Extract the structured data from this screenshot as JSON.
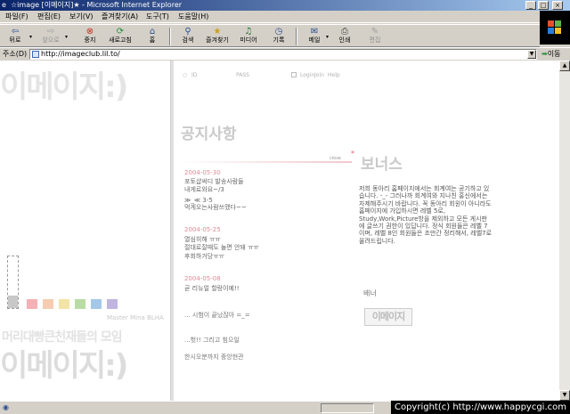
{
  "window": {
    "title": "☆image [이메이지]★ - Microsoft Internet Explorer"
  },
  "menu": [
    "파일(F)",
    "편집(E)",
    "보기(V)",
    "즐겨찾기(A)",
    "도구(T)",
    "도움말(H)"
  ],
  "toolbar": {
    "back": "뒤로",
    "forward": "앞으로",
    "stop": "중지",
    "refresh": "새로고침",
    "home": "홈",
    "search": "검색",
    "favorites": "즐겨찾기",
    "media": "미디어",
    "history": "기록",
    "mail": "메일",
    "print": "인쇄",
    "edit": "편집"
  },
  "address": {
    "label": "주소(D)",
    "url": "http://imageclub.lil.to/",
    "go": "이동"
  },
  "page": {
    "left_title": "이메이지:)",
    "left_slogan": "머리대빵큰천재들의 모임",
    "left_bottom_title": "이메이지:)",
    "master": "Master Mina BLHA",
    "swatches": [
      "#f4b0b4",
      "#f6cdb0",
      "#f2e4a4",
      "#b8dca4",
      "#a4c8e8",
      "#c0b4e0"
    ],
    "login": {
      "id": "ID",
      "pass": "PASS",
      "login": "Login",
      "join": "Join",
      "help": "Help"
    },
    "notice": {
      "title": "공지사항",
      "close": "close",
      "items": [
        {
          "date": "2004-05-30",
          "lines": [
            "포토샵써디 발송사람들",
            "내게로와요~/3",
            "≫_≪ 3-5",
            "먹게오는사람쓰맸다~~"
          ]
        },
        {
          "date": "2004-05-25",
          "lines": [
            "열심히해 ㅠㅠ",
            "절대로잘때도 놀면 안돼 ㅠㅠ",
            "후회하거당ㅠㅠ"
          ]
        },
        {
          "date": "2004-05-08",
          "lines": [
            "곧 리뉴얼 할랑이예!!"
          ]
        }
      ],
      "extra": [
        "... 시험이 끝났잖아 =_=",
        "...헛!! 그리고 힘으일",
        "한시오분까지 중앙현관"
      ]
    },
    "bonus": {
      "mark": "*",
      "title": "보너스",
      "body": "저희 동아리 홈페이지에서는 회계여는 공기하고 있습니다. -_- 그러나까 회계여와 지나친 홍신에서는 자제해주시기 바랍니다. 꼭 동아리 회원이 아니라도 홈페이지에 가입하시면 레벨 5로, Study,Work,Picture방을 제외하고 모든 게시판에 글쓰기 권한이 있답니다. 정식 회원들은 레벨 7이며, 레벨 8인 회원들은 조만간 정리해서, 레벨7로 올려드립니다."
    },
    "banner": {
      "label": "배너",
      "image_text": "이메이지"
    }
  },
  "status": {
    "copyright": "Copyright(c) http://www.happycgi.com"
  }
}
